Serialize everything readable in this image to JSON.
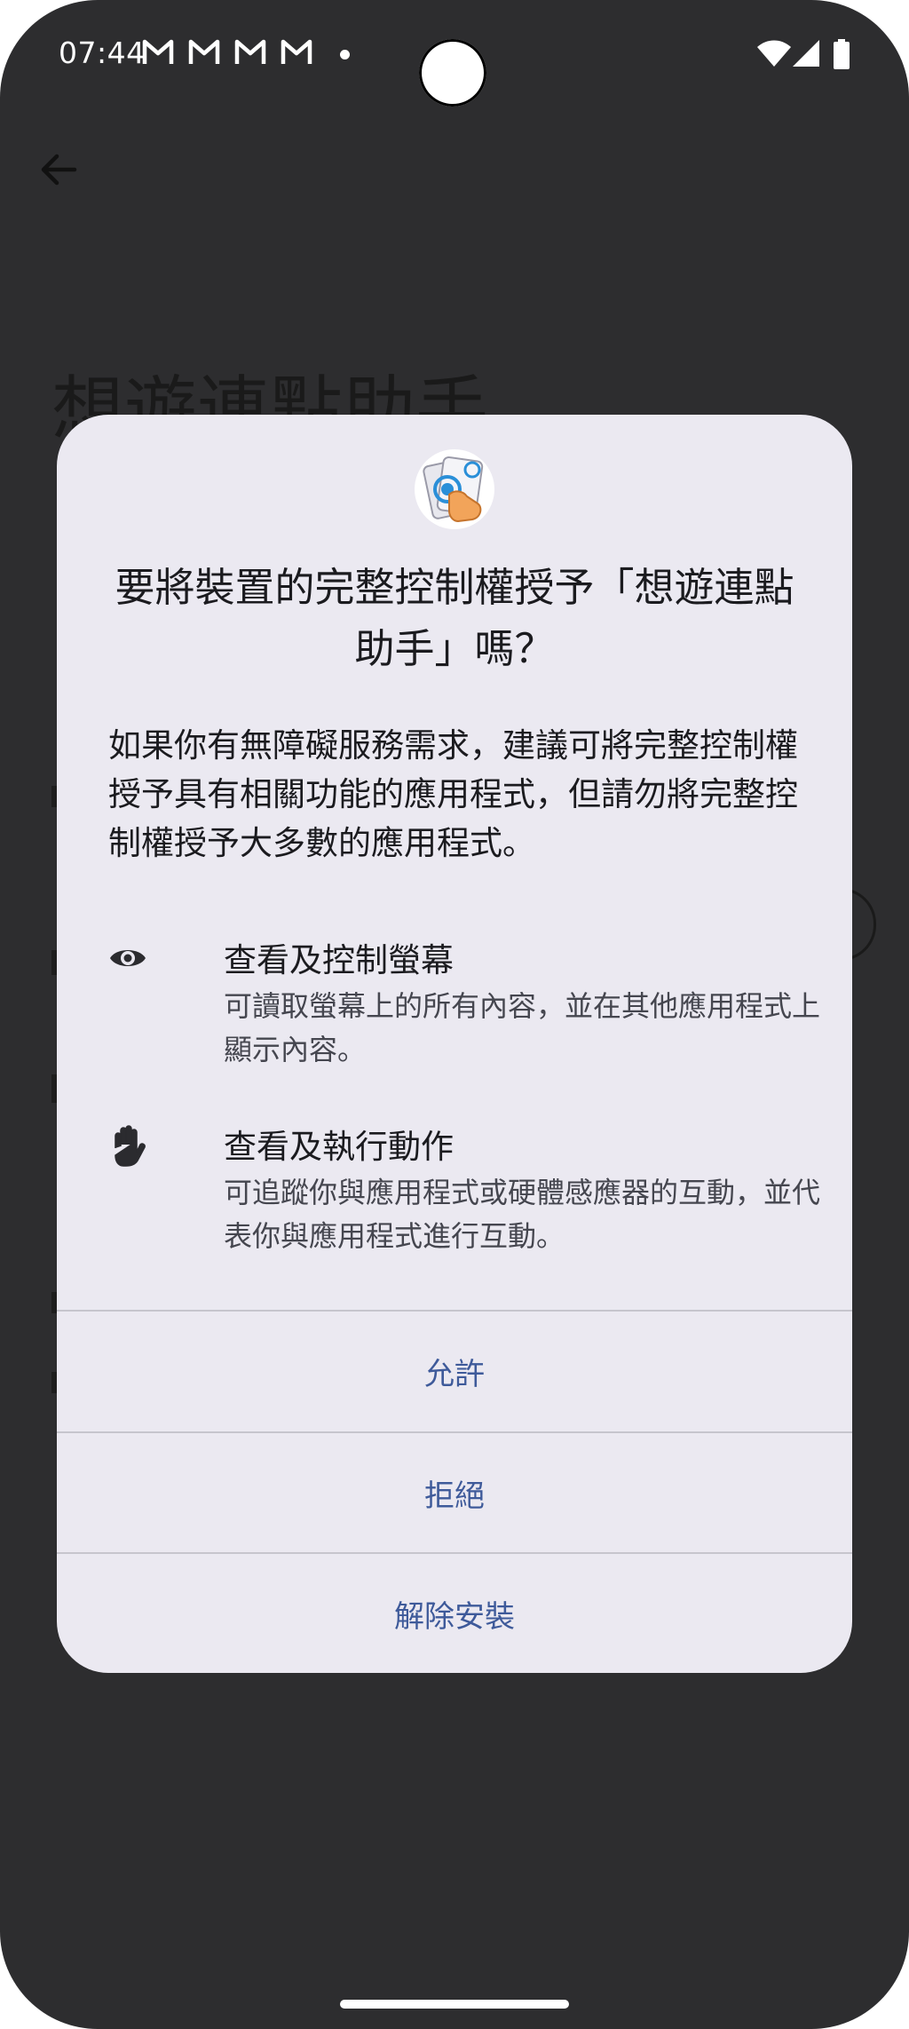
{
  "status_bar": {
    "time": "07:44",
    "notification_icons": [
      "gmail-icon",
      "gmail-icon",
      "gmail-icon",
      "gmail-icon"
    ],
    "icons": [
      "wifi-icon",
      "signal-icon",
      "battery-icon"
    ]
  },
  "background": {
    "title": "想遊連點助手"
  },
  "dialog": {
    "title": "要將裝置的完整控制權授予「想遊連點助手」嗎？",
    "description": "如果你有無障礙服務需求，建議可將完整控制權授予具有相關功能的應用程式，但請勿將完整控制權授予大多數的應用程式。",
    "permissions": [
      {
        "icon": "eye-icon",
        "title": "查看及控制螢幕",
        "description": "可讀取螢幕上的所有內容，並在其他應用程式上顯示內容。"
      },
      {
        "icon": "hand-icon",
        "title": "查看及執行動作",
        "description": "可追蹤你與應用程式或硬體感應器的互動，並代表你與應用程式進行互動。"
      }
    ],
    "buttons": {
      "allow": "允許",
      "deny": "拒絕",
      "uninstall": "解除安裝"
    }
  },
  "colors": {
    "scrim_background": "#2d2d2f",
    "dialog_surface": "#ebe9f1",
    "button_text": "#3e5a9a",
    "primary_text": "#1b1b1f",
    "secondary_text": "#45464f"
  }
}
